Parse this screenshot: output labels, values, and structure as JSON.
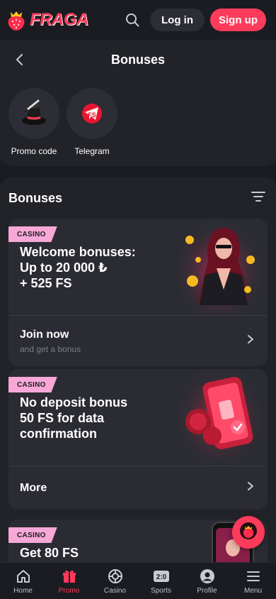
{
  "header": {
    "logo_text": "FRAGA",
    "search_icon": "search-icon",
    "login_label": "Log in",
    "signup_label": "Sign up"
  },
  "page": {
    "title": "Bonuses"
  },
  "quick_links": [
    {
      "label": "Promo code",
      "icon": "magic-hat-icon"
    },
    {
      "label": "Telegram",
      "icon": "telegram-fs-icon"
    }
  ],
  "bonuses": {
    "section_title": "Bonuses",
    "filter_icon": "filter-icon",
    "cards": [
      {
        "badge": "CASINO",
        "title_lines": [
          "Welcome bonuses:",
          "Up to 20 000 ₺",
          "+ 525 FS"
        ],
        "cta": "Join now",
        "cta_sub": "and get a bonus"
      },
      {
        "badge": "CASINO",
        "title_lines": [
          "No deposit bonus",
          "50 FS for data",
          "confirmation"
        ],
        "cta": "More",
        "cta_sub": ""
      },
      {
        "badge": "CASINO",
        "title_lines": [
          "Get 80 FS"
        ],
        "cta": "",
        "cta_sub": ""
      }
    ]
  },
  "nav": {
    "items": [
      {
        "label": "Home",
        "icon": "home-icon",
        "active": false
      },
      {
        "label": "Promo",
        "icon": "gift-icon",
        "active": true
      },
      {
        "label": "Casino",
        "icon": "roulette-icon",
        "active": false
      },
      {
        "label": "Sports",
        "icon": "scoreboard-icon",
        "score": "2:0",
        "active": false
      },
      {
        "label": "Profile",
        "icon": "profile-icon",
        "active": false
      },
      {
        "label": "Menu",
        "icon": "menu-icon",
        "active": false
      }
    ]
  },
  "colors": {
    "accent": "#ff3b5c",
    "badge": "#f7a8d7",
    "background": "#1b1c22",
    "panel": "#222329",
    "card": "#2b2c33"
  }
}
